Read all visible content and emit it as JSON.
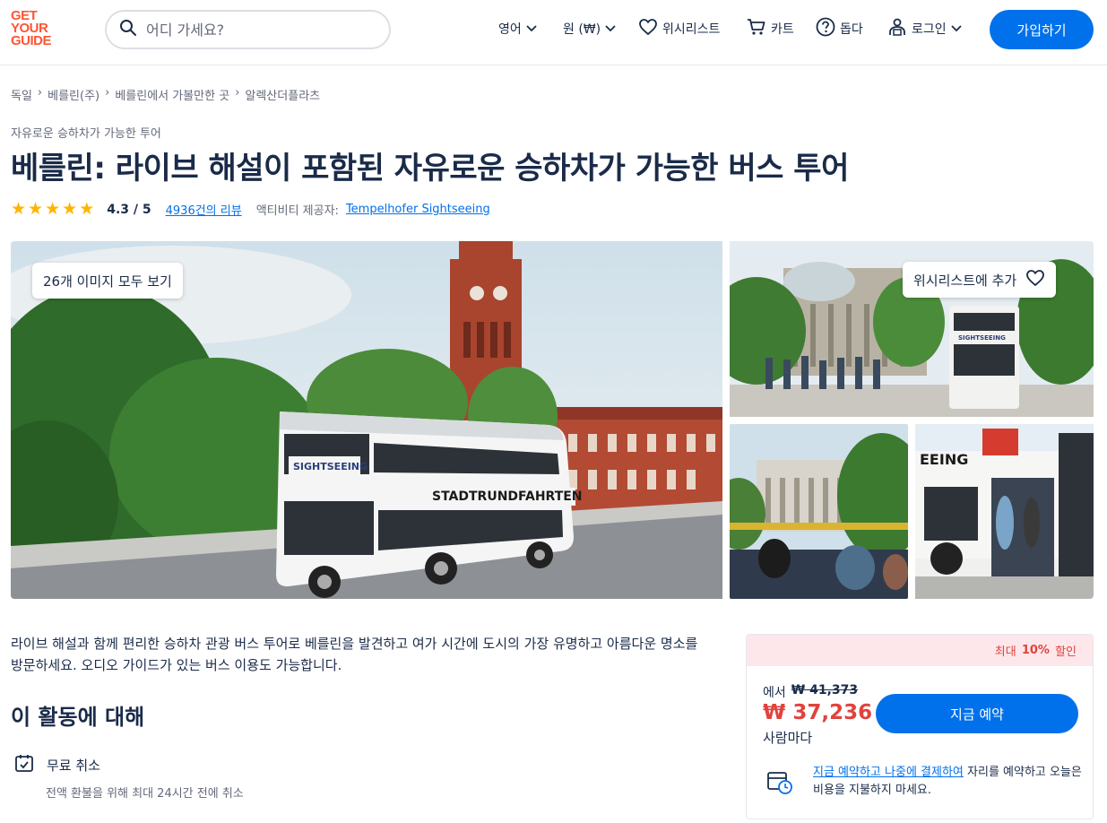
{
  "header": {
    "logo": [
      "GET",
      "YOUR",
      "GUIDE"
    ],
    "search_placeholder": "어디 가세요?",
    "language": "영어",
    "currency": "원 (₩)",
    "wishlist": "위시리스트",
    "cart": "카트",
    "help": "돕다",
    "login": "로그인",
    "signup": "가입하기"
  },
  "breadcrumb": [
    "독일",
    "베를린(주)",
    "베를린에서 가볼만한 곳",
    "알렉산더플라츠"
  ],
  "category": "자유로운 승하차가 가능한 투어",
  "title": "베를린: 라이브 해설이 포함된 자유로운 승하차가 가능한 버스 투어",
  "rating": {
    "stars": 5,
    "score": "4.3 / 5",
    "reviews": "4936건의 리뷰",
    "provider_label": "액티비티 제공자:",
    "provider": "Tempelhofer Sightseeing"
  },
  "gallery": {
    "view_all": "26개 이미지 모두 보기",
    "wishlist_add": "위시리스트에 추가"
  },
  "description": "라이브 해설과 함께 편리한 승하차 관광 버스 투어로 베를린을 발견하고 여가 시간에 도시의 가장 유명하고 아름다운 명소를 방문하세요. 오디오 가이드가 있는 버스 이용도 가능합니다.",
  "about": {
    "heading": "이 활동에 대해",
    "feature_title": "무료 취소",
    "feature_sub": "전액 환불을 위해 최대 24시간 전에 취소"
  },
  "booking": {
    "banner_prefix": "최대",
    "banner_value": "10%",
    "banner_suffix": "할인",
    "from_label": "에서",
    "old_price": "₩ 41,373",
    "price": "₩ 37,236",
    "per": "사람마다",
    "button": "지금 예약",
    "note_link": "지금 예약하고 나중에 결제하여",
    "note_rest": " 자리를 예약하고 오늘은 비용을 지불하지 마세요."
  },
  "colors": {
    "accent": "#0071eb",
    "brand": "#ff5533",
    "discount": "#e0433d",
    "star": "#ffb400"
  }
}
